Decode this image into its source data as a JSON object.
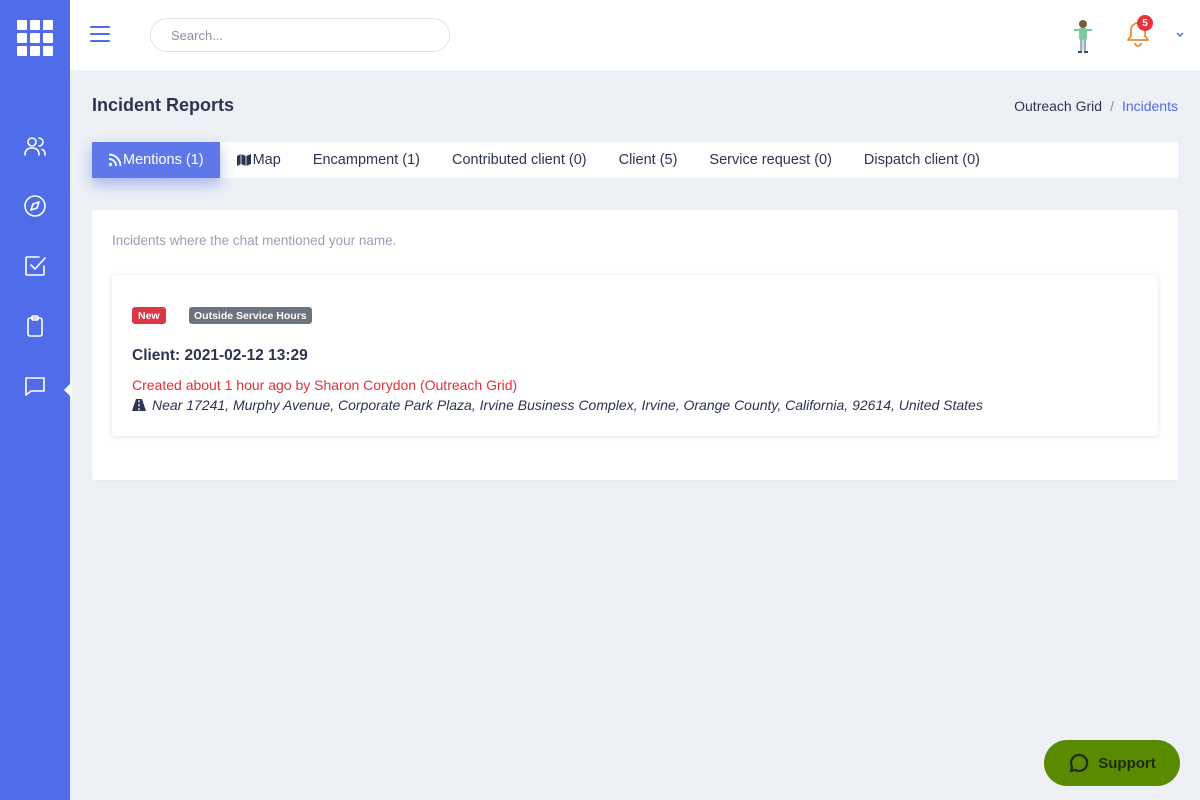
{
  "colors": {
    "sidebar": "#4f6ce9",
    "accent": "#4f6ce9",
    "danger": "#dc3545",
    "muted_badge": "#6c757d",
    "support": "#5a8a00"
  },
  "sidebar": {
    "items": [
      {
        "icon": "users-icon"
      },
      {
        "icon": "compass-icon"
      },
      {
        "icon": "checkbox-icon"
      },
      {
        "icon": "clipboard-icon"
      },
      {
        "icon": "chat-icon"
      }
    ]
  },
  "header": {
    "search_placeholder": "Search...",
    "notifications_count": "5"
  },
  "page": {
    "title": "Incident Reports",
    "breadcrumb": {
      "root": "Outreach Grid",
      "separator": "/",
      "current": "Incidents"
    }
  },
  "tabs": [
    {
      "label": "Mentions (1)",
      "icon": "rss-icon",
      "active": true
    },
    {
      "label": "Map",
      "icon": "map-icon",
      "active": false
    },
    {
      "label": "Encampment (1)",
      "active": false
    },
    {
      "label": "Contributed client (0)",
      "active": false
    },
    {
      "label": "Client (5)",
      "active": false
    },
    {
      "label": "Service request (0)",
      "active": false
    },
    {
      "label": "Dispatch client (0)",
      "active": false
    }
  ],
  "mentions": {
    "description": "Incidents where the chat mentioned your name.",
    "incident": {
      "badge_new": "New",
      "badge_hours": "Outside Service Hours",
      "title": "Client: 2021-02-12 13:29",
      "created": "Created about 1 hour ago by Sharon Corydon (Outreach Grid)",
      "location": "Near 17241, Murphy Avenue, Corporate Park Plaza, Irvine Business Complex, Irvine, Orange County, California, 92614, United States"
    }
  },
  "support": {
    "label": "Support"
  }
}
